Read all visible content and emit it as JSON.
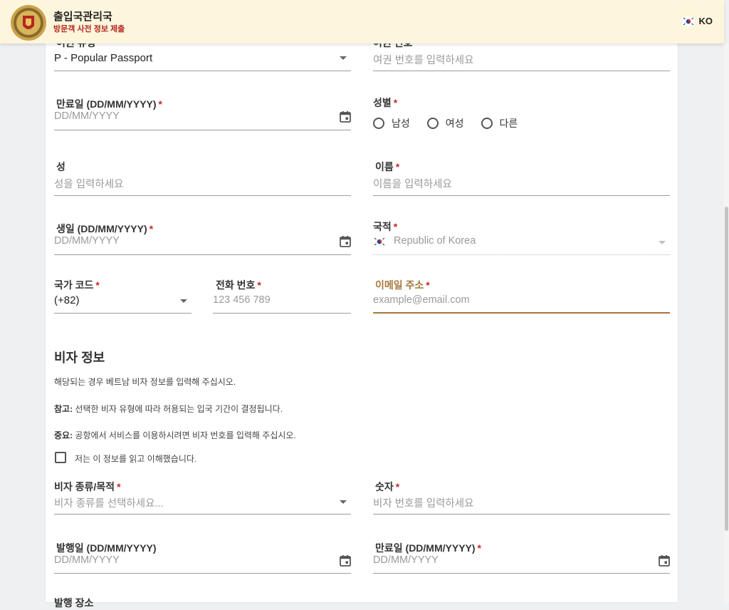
{
  "header": {
    "title": "출입국관리국",
    "subtitle": "방문객 사전 정보 제출",
    "language": "KO"
  },
  "form": {
    "passport_type": {
      "label": "여권 유형",
      "value": "P - Popular Passport"
    },
    "passport_number": {
      "label": "여권 번호",
      "placeholder": "여권 번호를 입력하세요"
    },
    "expiry_date": {
      "label": "만료일 (DD/MM/YYYY)",
      "placeholder": "DD/MM/YYYY"
    },
    "gender": {
      "label": "성별",
      "options": [
        "남성",
        "여성",
        "다른"
      ]
    },
    "last_name": {
      "label": "성",
      "placeholder": "성을 입력하세요"
    },
    "first_name": {
      "label": "이름",
      "placeholder": "이름을 입력하세요"
    },
    "birth_date": {
      "label": "생일 (DD/MM/YYYY)",
      "placeholder": "DD/MM/YYYY"
    },
    "nationality": {
      "label": "국적",
      "value": "Republic of Korea"
    },
    "country_code": {
      "label": "국가 코드",
      "value": "(+82)"
    },
    "phone": {
      "label": "전화 번호",
      "placeholder": "123 456 789"
    },
    "email": {
      "label": "이메일 주소",
      "placeholder": "example@email.com"
    },
    "required_mark": "*"
  },
  "visa": {
    "title": "비자 정보",
    "note1": "해당되는 경우 베트남 비자 정보를 입력해 주십시오.",
    "note2_label": "참고:",
    "note2": " 선택한 비자 유형에 따라 허용되는 입국 기간이 결정됩니다.",
    "note3_label": "중요:",
    "note3": " 공항에서 서비스를 이용하시려면 비자 번호를 입력해 주십시오.",
    "acknowledge": "저는 이 정보를 읽고 이해했습니다.",
    "visa_type": {
      "label": "비자 종류/목적",
      "placeholder": "비자 종류를 선택하세요..."
    },
    "visa_number": {
      "label": "숫자",
      "placeholder": "비자 번호를 입력하세요"
    },
    "issue_date": {
      "label": "발행일 (DD/MM/YYYY)",
      "placeholder": "DD/MM/YYYY"
    },
    "visa_expiry": {
      "label": "만료일 (DD/MM/YYYY)",
      "placeholder": "DD/MM/YYYY"
    },
    "issue_place": {
      "label": "발행 장소"
    }
  },
  "icons": {
    "emblem": "immigration-emblem",
    "flag": "south-korea-flag-icon",
    "calendar": "calendar-icon",
    "caret": "dropdown-arrow-icon"
  },
  "colors": {
    "header_bg": "#fdf6dd",
    "subtitle": "#b5271f",
    "required": "#c62828",
    "focus": "#a8773a"
  }
}
